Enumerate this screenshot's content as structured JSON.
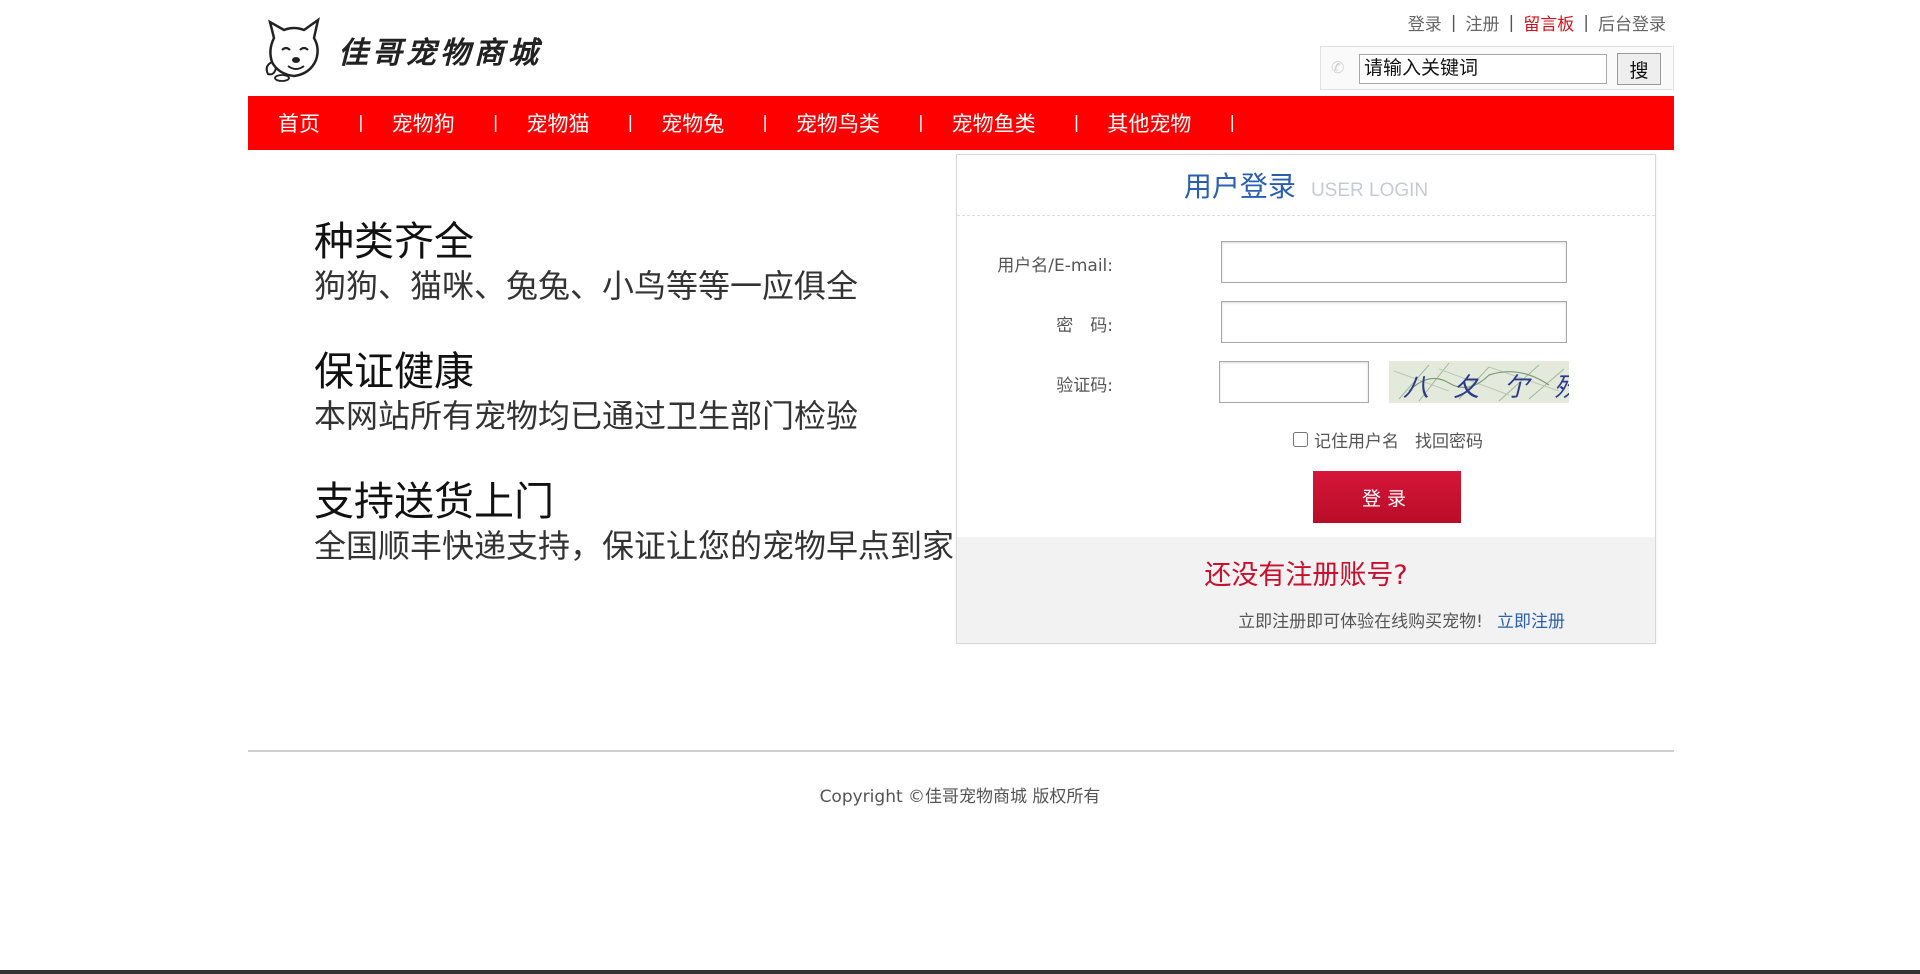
{
  "header": {
    "logo_text": "佳哥宠物商城",
    "top_links": [
      {
        "label": "登录"
      },
      {
        "label": "注册"
      },
      {
        "label": "留言板"
      },
      {
        "label": "后台登录"
      }
    ],
    "search": {
      "placeholder": "请输入关键词",
      "button_label": "搜"
    }
  },
  "nav": {
    "items": [
      {
        "label": "首页"
      },
      {
        "label": "宠物狗"
      },
      {
        "label": "宠物猫"
      },
      {
        "label": "宠物兔"
      },
      {
        "label": "宠物鸟类"
      },
      {
        "label": "宠物鱼类"
      },
      {
        "label": "其他宠物"
      }
    ]
  },
  "features": [
    {
      "title": "种类齐全",
      "desc": "狗狗、猫咪、兔兔、小鸟等等一应俱全"
    },
    {
      "title": "保证健康",
      "desc": "本网站所有宠物均已通过卫生部门检验"
    },
    {
      "title": "支持送货上门",
      "desc": "全国顺丰快递支持，保证让您的宠物早点到家"
    }
  ],
  "login": {
    "title": "用户登录",
    "subtitle": "USER LOGIN",
    "username_label": "用户名/E-mail:",
    "password_label": "密　码:",
    "captcha_label": "验证码:",
    "captcha_text": "八 夂 亇 殀",
    "remember_label": "记住用户名",
    "forgot_label": "找回密码",
    "submit_label": "登录",
    "register_question": "还没有注册账号?",
    "register_prompt": "立即注册即可体验在线购买宠物!",
    "register_link": "立即注册"
  },
  "footer": {
    "copyright": "Copyright ©佳哥宠物商城 版权所有"
  },
  "colors": {
    "nav_bg": "#ff0000",
    "login_button": "#c8102e",
    "login_title": "#2a5fb0",
    "highlight_link": "#d0121b"
  }
}
